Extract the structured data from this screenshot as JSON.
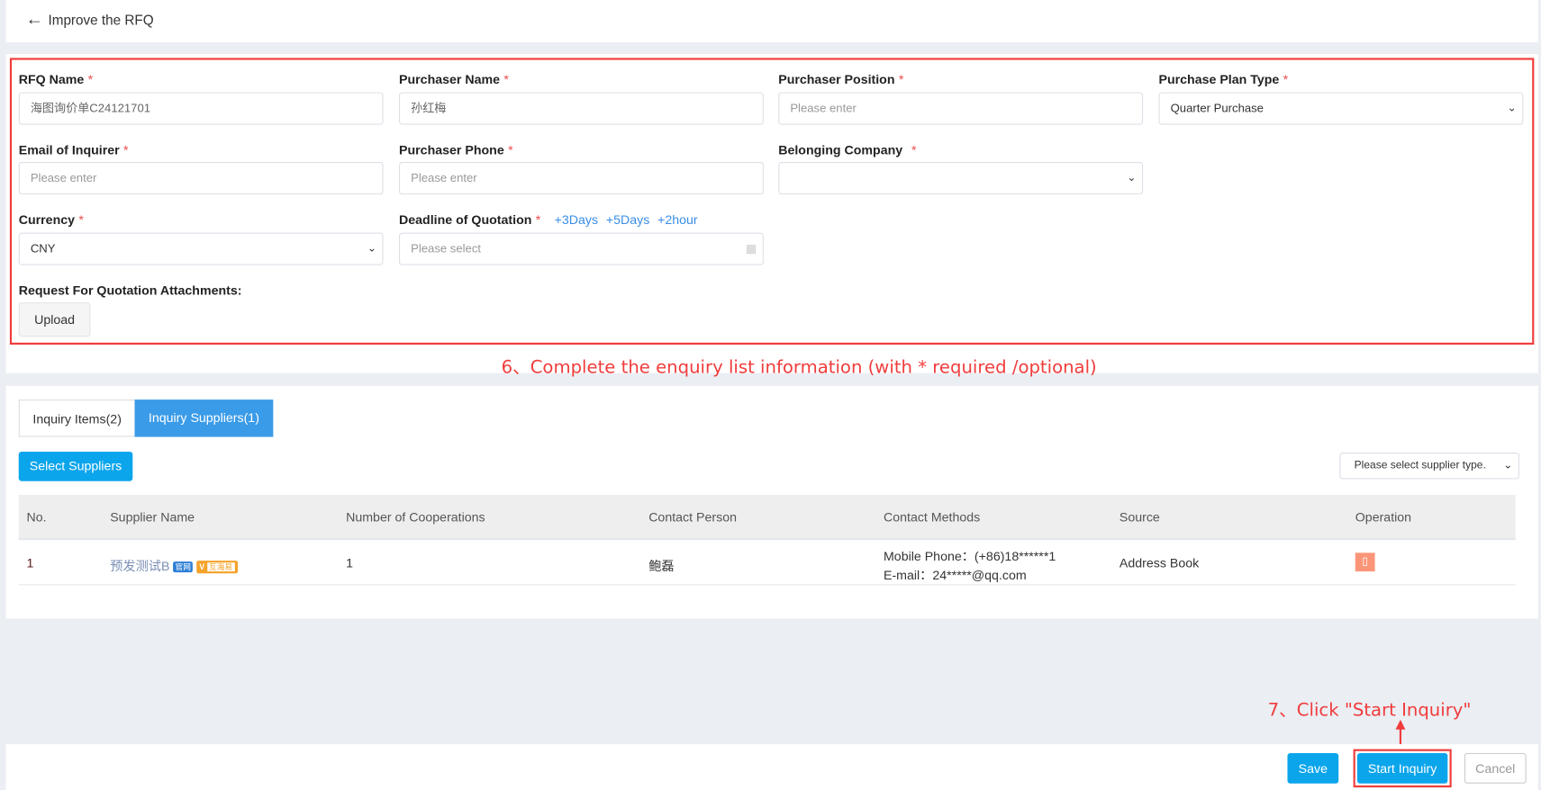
{
  "header": {
    "title": "Improve the RFQ",
    "back_icon": "arrow-left-icon"
  },
  "form": {
    "rfq_name": {
      "label": "RFQ Name",
      "value": "海图询价单C24121701"
    },
    "purchaser_name": {
      "label": "Purchaser Name",
      "value": "孙红梅"
    },
    "purchaser_position": {
      "label": "Purchaser Position",
      "placeholder": "Please enter"
    },
    "purchase_plan_type": {
      "label": "Purchase Plan Type",
      "value": "Quarter Purchase"
    },
    "email": {
      "label": "Email of Inquirer",
      "placeholder": "Please enter"
    },
    "purchaser_phone": {
      "label": "Purchaser Phone",
      "placeholder": "Please enter"
    },
    "belonging_company": {
      "label": "Belonging Company",
      "value": ""
    },
    "currency": {
      "label": "Currency",
      "value": "CNY"
    },
    "deadline": {
      "label": "Deadline of Quotation",
      "placeholder": "Please select",
      "quick": [
        "+3Days",
        "+5Days",
        "+2hour"
      ]
    },
    "attachments": {
      "label": "Request For Quotation Attachments:",
      "upload": "Upload"
    },
    "required_mark": "*"
  },
  "annotations": {
    "step6": "6、Complete the enquiry list information (with * required /optional)",
    "step7": "7、Click \"Start Inquiry\"",
    "color": "#f03c3c"
  },
  "tabs": [
    {
      "label": "Inquiry Items(2)",
      "active": false
    },
    {
      "label": "Inquiry Suppliers(1)",
      "active": true
    }
  ],
  "toolbar": {
    "select_suppliers": "Select Suppliers",
    "supplier_type_placeholder": "Please select supplier type."
  },
  "table": {
    "columns": [
      "No.",
      "Supplier Name",
      "Number of Cooperations",
      "Contact Person",
      "Contact Methods",
      "Source",
      "Operation"
    ],
    "rows": [
      {
        "no": "1",
        "supplier": "预发测试B",
        "badge1": "官网",
        "badge2": "V",
        "badge3": "互海易",
        "cooperations": "1",
        "contact": "鲍磊",
        "phone": "Mobile Phone：(+86)18******1",
        "email": "E-mail：24*****@qq.com",
        "source": "Address Book",
        "operation_icon": "delete-icon"
      }
    ]
  },
  "footer": {
    "save": "Save",
    "start": "Start Inquiry",
    "cancel": "Cancel"
  },
  "colors": {
    "primary": "#0ba5ec",
    "tab_active": "#3a9be8",
    "danger": "#fb9578"
  }
}
